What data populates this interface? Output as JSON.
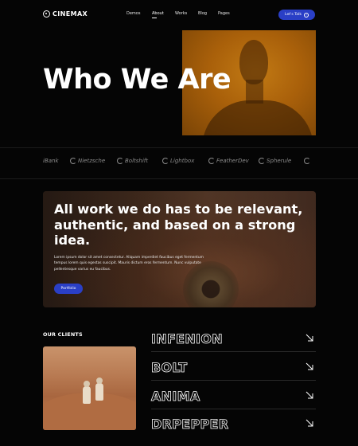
{
  "header": {
    "logo_text": "CINEMAX",
    "nav": [
      {
        "label": "Demos"
      },
      {
        "label": "About"
      },
      {
        "label": "Works"
      },
      {
        "label": "Blog"
      },
      {
        "label": "Pages"
      }
    ],
    "active_nav": "About",
    "cta_label": "Let's Talk",
    "cta_icon": "arrow-right-icon",
    "accent_color": "#2a3fc6"
  },
  "hero": {
    "title": "Who We Are"
  },
  "brands": [
    {
      "label": "iBank"
    },
    {
      "label": "Nietzsche"
    },
    {
      "label": "Boltshift"
    },
    {
      "label": "Lightbox"
    },
    {
      "label": "FeatherDev"
    },
    {
      "label": "Spherule"
    }
  ],
  "statement": {
    "title": "All work we do has to be relevant, authentic, and based on a strong idea.",
    "body": "Lorem ipsum dolor sit amet consectetur. Aliquam imperdiet faucibus eget fermentum tempus lorem quis egestas suscipit. Mauris dictum eros fermentum. Nunc vulputate pellentesque varius eu faucibus.",
    "button_label": "Portfolio"
  },
  "clients": {
    "heading": "OUR CLIENTS",
    "items": [
      {
        "name": "INFENION"
      },
      {
        "name": "BOLT"
      },
      {
        "name": "ANIMA"
      },
      {
        "name": "DRPEPPER"
      }
    ],
    "arrow_icon": "arrow-down-right-icon"
  }
}
